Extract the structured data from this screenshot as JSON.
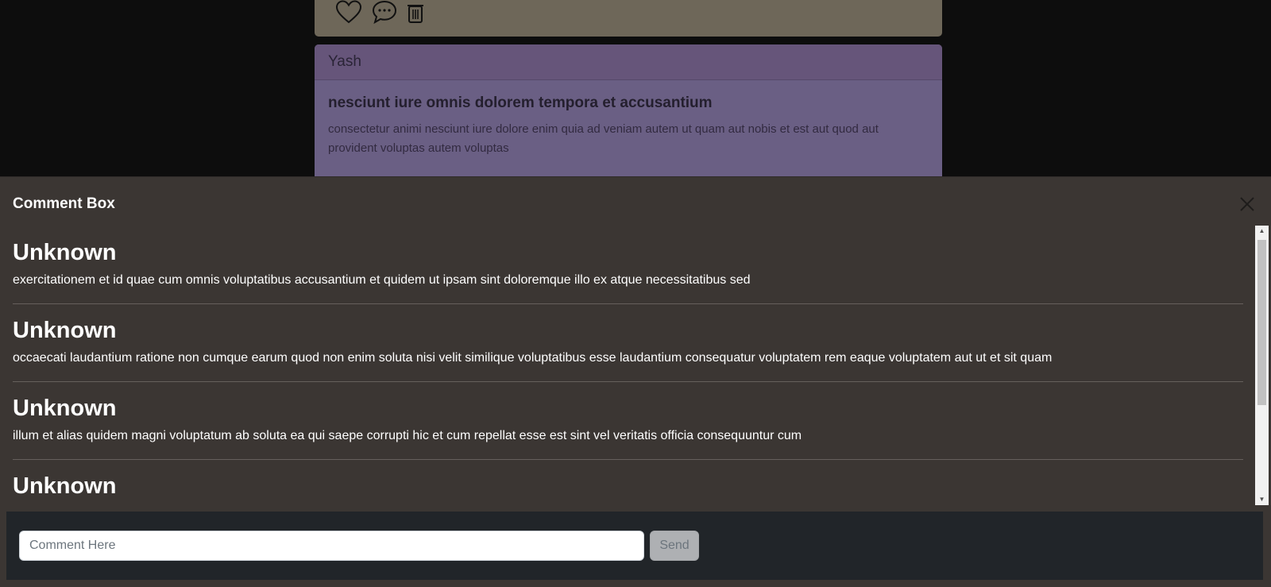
{
  "feed": {
    "post_author": "Yash",
    "post_title": "nesciunt iure omnis dolorem tempora et accusantium",
    "post_body": "consectetur animi nesciunt iure dolore enim quia ad veniam autem ut quam aut nobis et est aut quod aut provident voluptas autem voluptas"
  },
  "comment_box": {
    "title": "Comment Box",
    "comments": [
      {
        "author": "Unknown",
        "text": "exercitationem et id quae cum omnis voluptatibus accusantium et quidem ut ipsam sint doloremque illo ex atque necessitatibus sed"
      },
      {
        "author": "Unknown",
        "text": "occaecati laudantium ratione non cumque earum quod non enim soluta nisi velit similique voluptatibus esse laudantium consequatur voluptatem rem eaque voluptatem aut ut et sit quam"
      },
      {
        "author": "Unknown",
        "text": "illum et alias quidem magni voluptatum ab soluta ea qui saepe corrupti hic et cum repellat esse est sint vel veritatis officia consequuntur cum"
      },
      {
        "author": "Unknown",
        "text": ""
      }
    ],
    "input_placeholder": "Comment Here",
    "send_label": "Send"
  },
  "icons": [
    "heart-icon",
    "comment-icon",
    "delete-icon",
    "close-icon"
  ],
  "colors": {
    "post_card": "#6a5f84",
    "prev_card": "#6e6759",
    "comment_box_bg": "#3b3633",
    "footer_bg": "#212529"
  }
}
